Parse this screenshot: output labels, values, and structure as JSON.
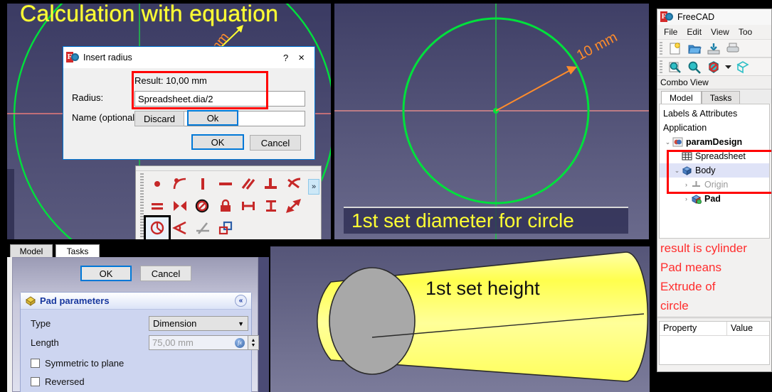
{
  "panel_a": {
    "title": "Calculation with equation",
    "hidden_dim_label": "mm",
    "dialog": {
      "window_title": "Insert radius",
      "help_btn": "?",
      "close_btn": "×",
      "result_label": "Result: 10,00 mm",
      "radius_label": "Radius:",
      "radius_value": "Spreadsheet.dia/2",
      "name_label": "Name (optional)",
      "name_value": "",
      "discard_btn": "Discard",
      "ok_small_btn": "Ok",
      "ok_btn": "OK",
      "cancel_btn": "Cancel"
    },
    "constraint_toolbar": {
      "expand_btn": "»",
      "icons": [
        "constrain-point-onto-object-icon",
        "constrain-tangent-icon",
        "constrain-vertical-icon",
        "constrain-horizontal-icon",
        "constrain-parallel-icon",
        "constrain-perpendicular-icon",
        "constrain-tangency-icon",
        "constrain-equal-icon",
        "constrain-symmetric-icon",
        "constrain-block-icon",
        "constrain-lock-icon",
        "constrain-horizontal-distance-icon",
        "constrain-vertical-distance-icon",
        "constrain-distance-icon",
        "constrain-radius-icon",
        "constrain-angle-icon",
        "constrain-refraction-icon",
        "toggle-driving-constraint-icon"
      ],
      "selected_icon": "constrain-radius-icon"
    }
  },
  "panel_b": {
    "caption": "1st set diameter for circle",
    "dimension_label": "10 mm"
  },
  "panel_c": {
    "tabs": [
      {
        "label": "Model",
        "active": false
      },
      {
        "label": "Tasks",
        "active": true
      }
    ],
    "ok_btn": "OK",
    "cancel_btn": "Cancel",
    "group_title": "Pad parameters",
    "collapse_btn": "«",
    "type_label": "Type",
    "type_value": "Dimension",
    "length_label": "Length",
    "length_value": "75,00 mm",
    "symmetric_label": "Symmetric to plane",
    "reversed_label": "Reversed"
  },
  "panel_d": {
    "caption": "1st set height"
  },
  "panel_e": {
    "app_title": "FreeCAD",
    "menu": [
      "File",
      "Edit",
      "View",
      "Too"
    ],
    "toolbar_row1": [
      "new-document-icon",
      "open-document-icon",
      "save-document-icon",
      "print-document-icon"
    ],
    "toolbar_row2": [
      "fit-all-icon",
      "zoom-icon",
      "no-refresh-icon",
      "dropdown-arrow-icon",
      "axonometric-view-icon"
    ],
    "combo_view_label": "Combo View",
    "combo_tabs": [
      {
        "label": "Model",
        "active": true
      },
      {
        "label": "Tasks",
        "active": false
      }
    ],
    "tree_header": "Labels & Attributes",
    "tree": [
      {
        "label": "Application",
        "indent": 0,
        "twist": "",
        "icon": "",
        "bold": false,
        "gray": false
      },
      {
        "label": "paramDesign",
        "indent": 1,
        "twist": "⌄",
        "icon": "document-icon",
        "bold": true,
        "gray": false
      },
      {
        "label": "Spreadsheet",
        "indent": 2,
        "twist": "",
        "icon": "spreadsheet-icon",
        "bold": false,
        "gray": false
      },
      {
        "label": "Body",
        "indent": 2,
        "twist": "⌄",
        "icon": "body-icon",
        "bold": false,
        "gray": false
      },
      {
        "label": "Origin",
        "indent": 3,
        "twist": "›",
        "icon": "origin-icon",
        "bold": false,
        "gray": true
      },
      {
        "label": "Pad",
        "indent": 3,
        "twist": "›",
        "icon": "pad-icon",
        "bold": true,
        "gray": false
      }
    ],
    "annotations": [
      "result is cylinder",
      "Pad means",
      "Extrude of",
      "circle"
    ],
    "property_header": [
      "Property",
      "Value"
    ]
  },
  "colors": {
    "annotation_red": "#ff2d2d",
    "highlight_red": "#ff0000",
    "caption_yellow": "#ffff33",
    "sketch_green": "#00e03c",
    "dimension_orange": "#ff8c2b",
    "accent_blue": "#0078d7",
    "cylinder_yellow": "#ffff66"
  }
}
